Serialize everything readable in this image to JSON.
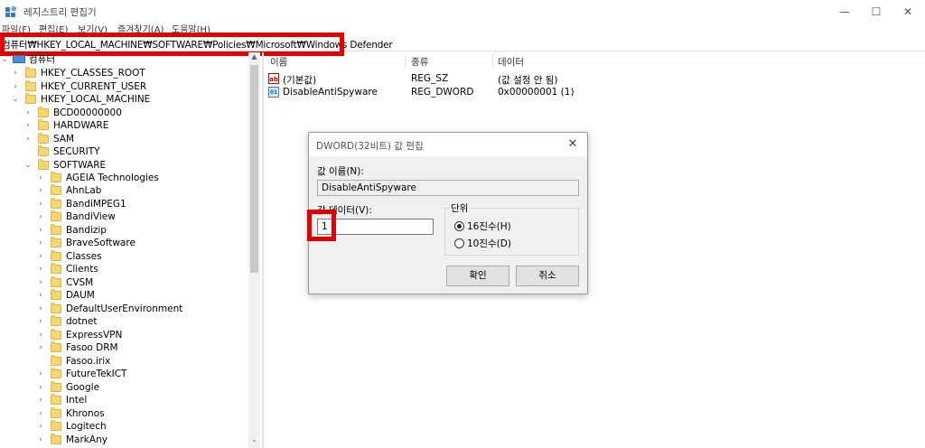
{
  "window": {
    "title": "레지스트리 편집기",
    "minimize": "—",
    "maximize": "☐",
    "close": "✕"
  },
  "menu": [
    "파일(F)",
    "편집(E)",
    "보기(V)",
    "즐겨찾기(A)",
    "도움말(H)"
  ],
  "address": "컴퓨터₩HKEY_LOCAL_MACHINE₩SOFTWARE₩Policies₩Microsoft₩Windows Defender",
  "tree": {
    "root": "컴퓨터",
    "hives": [
      "HKEY_CLASSES_ROOT",
      "HKEY_CURRENT_USER",
      "HKEY_LOCAL_MACHINE"
    ],
    "hklm_children": [
      "BCD00000000",
      "HARDWARE",
      "SAM",
      "SECURITY",
      "SOFTWARE"
    ],
    "software_children": [
      "AGEIA Technologies",
      "AhnLab",
      "BandiMPEG1",
      "BandiView",
      "Bandizip",
      "BraveSoftware",
      "Classes",
      "Clients",
      "CVSM",
      "DAUM",
      "DefaultUserEnvironment",
      "dotnet",
      "ExpressVPN",
      "Fasoo DRM",
      "Fasoo.irix",
      "FutureTekICT",
      "Google",
      "Intel",
      "Khronos",
      "Logitech",
      "MarkAny"
    ]
  },
  "list": {
    "columns": [
      "이름",
      "종류",
      "데이터"
    ],
    "rows": [
      {
        "name": "(기본값)",
        "type": "REG_SZ",
        "data": "(값 설정 안 됨)",
        "icon": "ab-icon"
      },
      {
        "name": "DisableAntiSpyware",
        "type": "REG_DWORD",
        "data": "0x00000001 (1)",
        "icon": "binary-icon"
      }
    ]
  },
  "dialog": {
    "title": "DWORD(32비트) 값 편집",
    "name_label": "값 이름(N):",
    "name_value": "DisableAntiSpyware",
    "data_label": "값 데이터(V):",
    "data_value": "1",
    "base_label": "단위",
    "hex_label": "16진수(H)",
    "dec_label": "10진수(D)",
    "selected_base": "hex",
    "ok": "확인",
    "cancel": "취소"
  },
  "highlight_color": "#e00000"
}
